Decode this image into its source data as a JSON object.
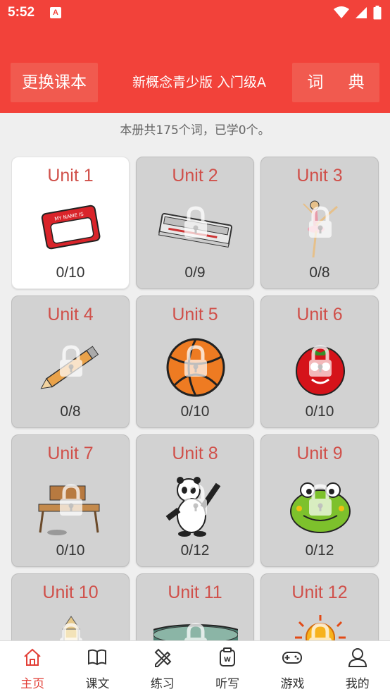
{
  "status": {
    "time": "5:52",
    "app_icon": "A"
  },
  "header": {
    "change_book_label": "更换课本",
    "book_title": "新概念青少版 入门级A",
    "dictionary_label": "词 典"
  },
  "summary": "本册共175个词，已学0个。",
  "units": [
    {
      "label": "Unit 1",
      "progress": "0/10",
      "locked": false,
      "icon": "name-tag-icon"
    },
    {
      "label": "Unit 2",
      "progress": "0/9",
      "locked": true,
      "icon": "pencil-case-icon"
    },
    {
      "label": "Unit 3",
      "progress": "0/8",
      "locked": true,
      "icon": "ballerina-icon"
    },
    {
      "label": "Unit 4",
      "progress": "0/8",
      "locked": true,
      "icon": "pencil-icon"
    },
    {
      "label": "Unit 5",
      "progress": "0/10",
      "locked": true,
      "icon": "volleyball-icon"
    },
    {
      "label": "Unit 6",
      "progress": "0/10",
      "locked": true,
      "icon": "tomato-icon"
    },
    {
      "label": "Unit 7",
      "progress": "0/10",
      "locked": true,
      "icon": "chair-icon"
    },
    {
      "label": "Unit 8",
      "progress": "0/12",
      "locked": true,
      "icon": "panda-icon"
    },
    {
      "label": "Unit 9",
      "progress": "0/12",
      "locked": true,
      "icon": "frog-icon"
    },
    {
      "label": "Unit 10",
      "progress": "",
      "locked": true,
      "icon": "house-icon"
    },
    {
      "label": "Unit 11",
      "progress": "",
      "locked": true,
      "icon": "disc-icon"
    },
    {
      "label": "Unit 12",
      "progress": "",
      "locked": true,
      "icon": "sun-icon"
    }
  ],
  "nav": [
    {
      "label": "主页",
      "icon": "home-icon",
      "active": true
    },
    {
      "label": "课文",
      "icon": "book-icon",
      "active": false
    },
    {
      "label": "练习",
      "icon": "pencil-ruler-icon",
      "active": false
    },
    {
      "label": "听写",
      "icon": "dictation-icon",
      "active": false
    },
    {
      "label": "游戏",
      "icon": "gamepad-icon",
      "active": false
    },
    {
      "label": "我的",
      "icon": "user-icon",
      "active": false
    }
  ],
  "colors": {
    "primary": "#f2423a",
    "unit_text": "#d0504a",
    "nav_active": "#e23e36"
  }
}
